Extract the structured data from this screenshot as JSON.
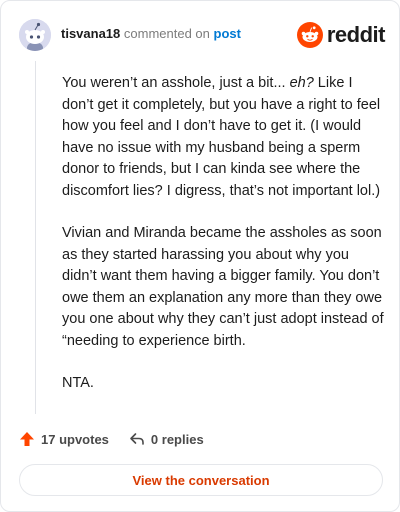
{
  "comment": {
    "username": "tisvana18",
    "commented_on": "commented on",
    "post_link": "post",
    "p1_a": "You weren’t an asshole, just a bit... ",
    "p1_em": "eh?",
    "p1_b": " Like I don’t get it completely, but you have a right to feel how you feel and I don’t have to get it. (I would have no issue with my husband being a sperm donor to friends, but I can kinda see where the discomfort lies? I digress, that’s not important lol.)",
    "p2": "Vivian and Miranda became the assholes as soon as they started harassing you about why you didn’t want them having a bigger family. You don’t owe them an explanation any more than they owe you one about why they can’t just adopt instead of “needing to experience birth.",
    "p3": "NTA."
  },
  "brand": {
    "wordmark": "reddit",
    "accent": "#ff4500"
  },
  "actions": {
    "upvotes": "17 upvotes",
    "replies": "0 replies",
    "upvote_icon": "upvote-arrow-icon",
    "reply_icon": "reply-icon"
  },
  "cta": {
    "label": "View the conversation"
  },
  "colors": {
    "link": "#0079d3",
    "cta_text": "#d93a00",
    "upvote": "#ff4500"
  }
}
